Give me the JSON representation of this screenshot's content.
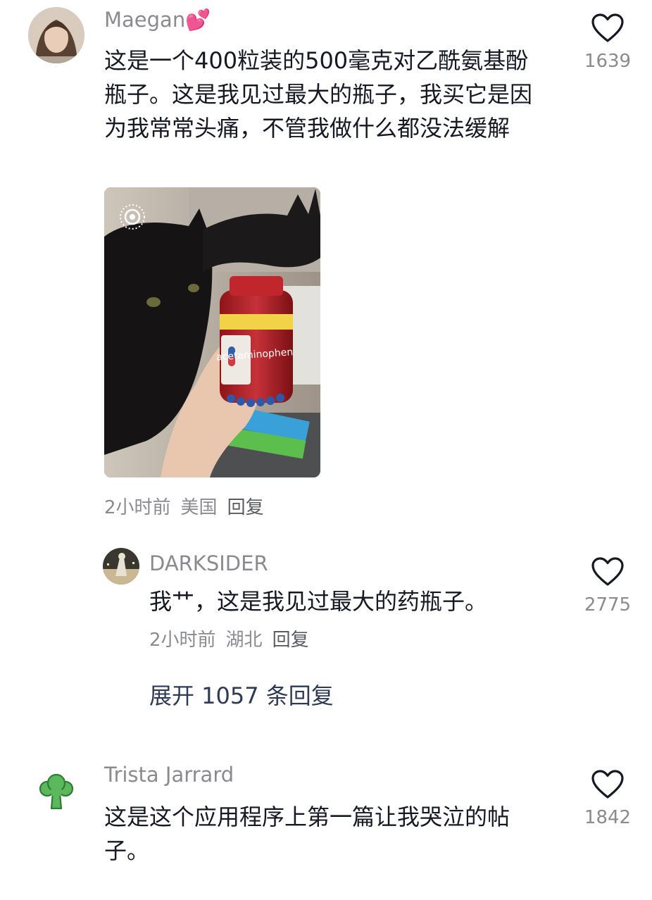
{
  "comments": [
    {
      "username": "Maegan",
      "username_emoji": "💕",
      "text": "这是一个400粒装的500毫克对乙酰氨基酚瓶子。这是我见过最大的瓶子，我买它是因为我常常头痛，不管我做什么都没法缓解",
      "photo_label": "acetaminophen",
      "time": "2小时前",
      "location": "美国",
      "reply_label": "回复",
      "likes": "1639"
    },
    {
      "username": "DARKSIDER",
      "text": "我艹，这是我见过最大的药瓶子。",
      "time": "2小时前",
      "location": "湖北",
      "reply_label": "回复",
      "likes": "2775"
    },
    {
      "username": "Trista Jarrard",
      "text": "这是这个应用程序上第一篇让我哭泣的帖子。",
      "likes": "1842"
    }
  ],
  "expand_replies": "展开 1057 条回复",
  "icons": {
    "like": "heart-outline-icon",
    "avatar_trista": "broccoli-icon",
    "live_photo": "live-photo-icon"
  },
  "colors": {
    "text": "#161823",
    "secondary": "#8a8b91",
    "pill_cap": "#c0262b",
    "broccoli": "#5cb85c"
  }
}
